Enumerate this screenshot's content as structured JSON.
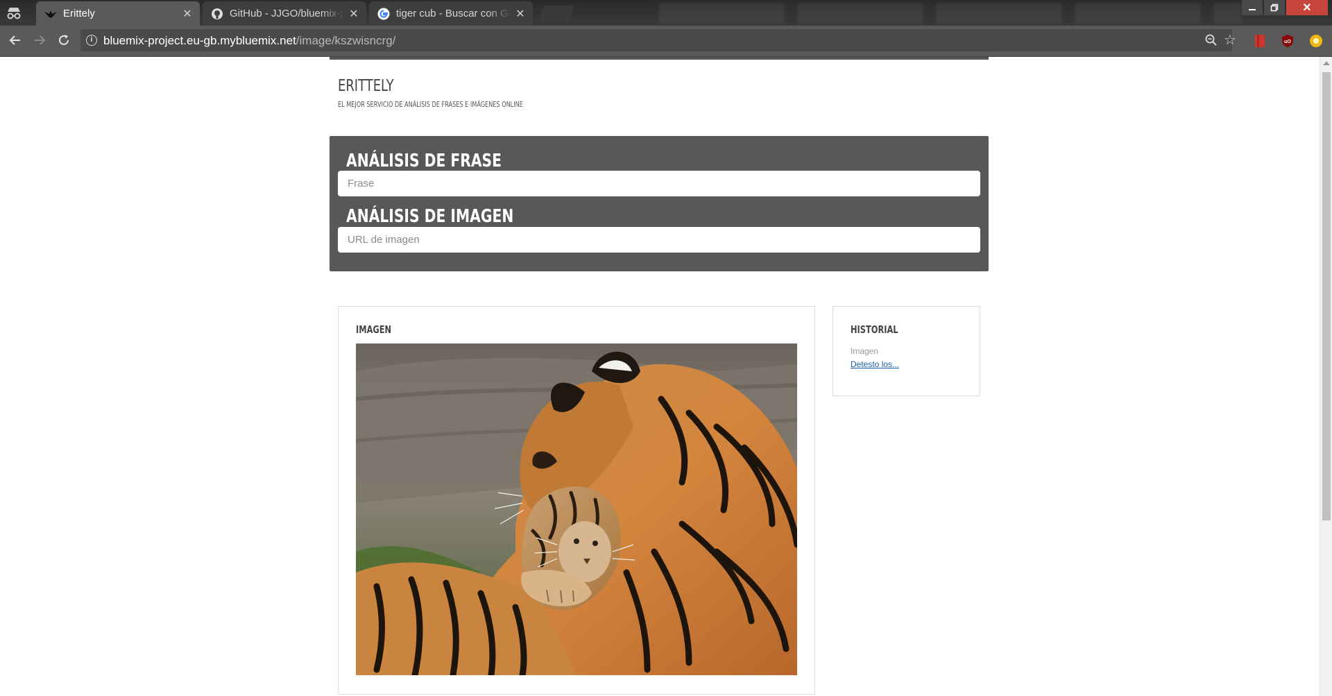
{
  "browser": {
    "tabs": [
      {
        "title": "Erittely",
        "active": true,
        "icon": "bird-icon"
      },
      {
        "title": "GitHub - JJGO/bluemix-project",
        "active": false,
        "icon": "github-icon"
      },
      {
        "title": "tiger cub - Buscar con Google",
        "active": false,
        "icon": "google-icon"
      }
    ],
    "url_host": "bluemix-project.eu-gb.mybluemix.net",
    "url_path": "/image/kszwisncrg/"
  },
  "site": {
    "title": "ERITTELY",
    "subtitle": "EL MEJOR SERVICIO DE ANÁLISIS DE FRASES E IMÁGENES ONLINE"
  },
  "analysis": {
    "phrase_heading": "ANÁLISIS DE FRASE",
    "phrase_placeholder": "Frase",
    "image_heading": "ANÁLISIS DE IMAGEN",
    "image_placeholder": "URL de imagen"
  },
  "image_card": {
    "title": "IMAGEN"
  },
  "history": {
    "title": "HISTORIAL",
    "items": [
      {
        "type": "Imagen",
        "link": "Detesto los..."
      }
    ]
  },
  "colors": {
    "panel": "#585858",
    "link": "#1a5fa8",
    "chrome": "#5a5a5a"
  }
}
